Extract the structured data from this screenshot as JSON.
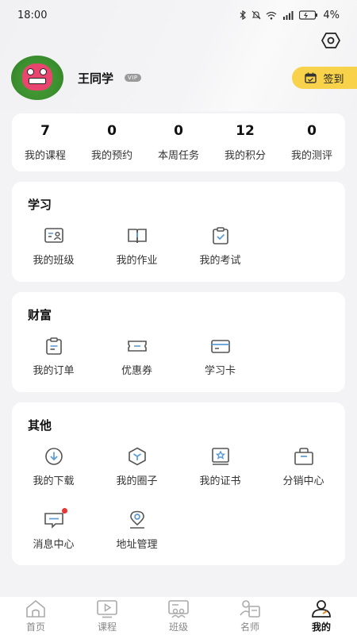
{
  "status": {
    "time": "18:00",
    "battery": "4%"
  },
  "profile": {
    "name": "王同学",
    "vip": "VIP",
    "checkin_label": "签到"
  },
  "stats": [
    {
      "value": "7",
      "label": "我的课程"
    },
    {
      "value": "0",
      "label": "我的预约"
    },
    {
      "value": "0",
      "label": "本周任务"
    },
    {
      "value": "12",
      "label": "我的积分"
    },
    {
      "value": "0",
      "label": "我的测评"
    }
  ],
  "study": {
    "title": "学习",
    "items": [
      {
        "label": "我的班级",
        "icon": "class-icon"
      },
      {
        "label": "我的作业",
        "icon": "homework-icon"
      },
      {
        "label": "我的考试",
        "icon": "exam-icon"
      }
    ]
  },
  "wealth": {
    "title": "财富",
    "items": [
      {
        "label": "我的订单",
        "icon": "order-icon"
      },
      {
        "label": "优惠券",
        "icon": "coupon-icon"
      },
      {
        "label": "学习卡",
        "icon": "study-card-icon"
      }
    ]
  },
  "other": {
    "title": "其他",
    "items": [
      {
        "label": "我的下载",
        "icon": "download-icon"
      },
      {
        "label": "我的圈子",
        "icon": "circle-icon"
      },
      {
        "label": "我的证书",
        "icon": "certificate-icon"
      },
      {
        "label": "分销中心",
        "icon": "distribution-icon"
      },
      {
        "label": "消息中心",
        "icon": "message-icon"
      },
      {
        "label": "地址管理",
        "icon": "location-icon"
      }
    ]
  },
  "tabs": [
    {
      "label": "首页",
      "icon": "home-icon"
    },
    {
      "label": "课程",
      "icon": "course-icon"
    },
    {
      "label": "班级",
      "icon": "class-group-icon"
    },
    {
      "label": "名师",
      "icon": "teacher-icon"
    },
    {
      "label": "我的",
      "icon": "profile-icon",
      "active": true
    }
  ],
  "colors": {
    "accent": "#f7d24a",
    "icon_stroke": "#555555",
    "icon_highlight": "#5b9bd5",
    "badge": "#e53935"
  }
}
